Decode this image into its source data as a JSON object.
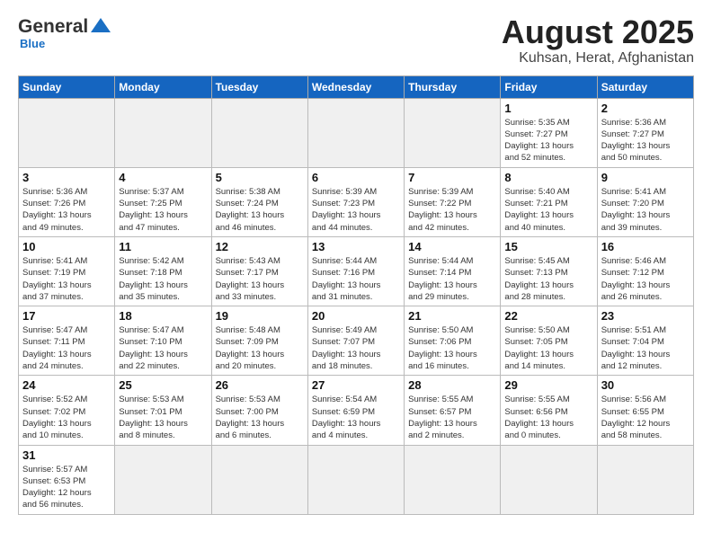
{
  "header": {
    "title": "August 2025",
    "subtitle": "Kuhsan, Herat, Afghanistan",
    "logo_general": "General",
    "logo_blue": "Blue"
  },
  "weekdays": [
    "Sunday",
    "Monday",
    "Tuesday",
    "Wednesday",
    "Thursday",
    "Friday",
    "Saturday"
  ],
  "days": [
    {
      "date": "",
      "info": ""
    },
    {
      "date": "",
      "info": ""
    },
    {
      "date": "",
      "info": ""
    },
    {
      "date": "",
      "info": ""
    },
    {
      "date": "",
      "info": ""
    },
    {
      "date": "1",
      "info": "Sunrise: 5:35 AM\nSunset: 7:27 PM\nDaylight: 13 hours\nand 52 minutes."
    },
    {
      "date": "2",
      "info": "Sunrise: 5:36 AM\nSunset: 7:27 PM\nDaylight: 13 hours\nand 50 minutes."
    },
    {
      "date": "3",
      "info": "Sunrise: 5:36 AM\nSunset: 7:26 PM\nDaylight: 13 hours\nand 49 minutes."
    },
    {
      "date": "4",
      "info": "Sunrise: 5:37 AM\nSunset: 7:25 PM\nDaylight: 13 hours\nand 47 minutes."
    },
    {
      "date": "5",
      "info": "Sunrise: 5:38 AM\nSunset: 7:24 PM\nDaylight: 13 hours\nand 46 minutes."
    },
    {
      "date": "6",
      "info": "Sunrise: 5:39 AM\nSunset: 7:23 PM\nDaylight: 13 hours\nand 44 minutes."
    },
    {
      "date": "7",
      "info": "Sunrise: 5:39 AM\nSunset: 7:22 PM\nDaylight: 13 hours\nand 42 minutes."
    },
    {
      "date": "8",
      "info": "Sunrise: 5:40 AM\nSunset: 7:21 PM\nDaylight: 13 hours\nand 40 minutes."
    },
    {
      "date": "9",
      "info": "Sunrise: 5:41 AM\nSunset: 7:20 PM\nDaylight: 13 hours\nand 39 minutes."
    },
    {
      "date": "10",
      "info": "Sunrise: 5:41 AM\nSunset: 7:19 PM\nDaylight: 13 hours\nand 37 minutes."
    },
    {
      "date": "11",
      "info": "Sunrise: 5:42 AM\nSunset: 7:18 PM\nDaylight: 13 hours\nand 35 minutes."
    },
    {
      "date": "12",
      "info": "Sunrise: 5:43 AM\nSunset: 7:17 PM\nDaylight: 13 hours\nand 33 minutes."
    },
    {
      "date": "13",
      "info": "Sunrise: 5:44 AM\nSunset: 7:16 PM\nDaylight: 13 hours\nand 31 minutes."
    },
    {
      "date": "14",
      "info": "Sunrise: 5:44 AM\nSunset: 7:14 PM\nDaylight: 13 hours\nand 29 minutes."
    },
    {
      "date": "15",
      "info": "Sunrise: 5:45 AM\nSunset: 7:13 PM\nDaylight: 13 hours\nand 28 minutes."
    },
    {
      "date": "16",
      "info": "Sunrise: 5:46 AM\nSunset: 7:12 PM\nDaylight: 13 hours\nand 26 minutes."
    },
    {
      "date": "17",
      "info": "Sunrise: 5:47 AM\nSunset: 7:11 PM\nDaylight: 13 hours\nand 24 minutes."
    },
    {
      "date": "18",
      "info": "Sunrise: 5:47 AM\nSunset: 7:10 PM\nDaylight: 13 hours\nand 22 minutes."
    },
    {
      "date": "19",
      "info": "Sunrise: 5:48 AM\nSunset: 7:09 PM\nDaylight: 13 hours\nand 20 minutes."
    },
    {
      "date": "20",
      "info": "Sunrise: 5:49 AM\nSunset: 7:07 PM\nDaylight: 13 hours\nand 18 minutes."
    },
    {
      "date": "21",
      "info": "Sunrise: 5:50 AM\nSunset: 7:06 PM\nDaylight: 13 hours\nand 16 minutes."
    },
    {
      "date": "22",
      "info": "Sunrise: 5:50 AM\nSunset: 7:05 PM\nDaylight: 13 hours\nand 14 minutes."
    },
    {
      "date": "23",
      "info": "Sunrise: 5:51 AM\nSunset: 7:04 PM\nDaylight: 13 hours\nand 12 minutes."
    },
    {
      "date": "24",
      "info": "Sunrise: 5:52 AM\nSunset: 7:02 PM\nDaylight: 13 hours\nand 10 minutes."
    },
    {
      "date": "25",
      "info": "Sunrise: 5:53 AM\nSunset: 7:01 PM\nDaylight: 13 hours\nand 8 minutes."
    },
    {
      "date": "26",
      "info": "Sunrise: 5:53 AM\nSunset: 7:00 PM\nDaylight: 13 hours\nand 6 minutes."
    },
    {
      "date": "27",
      "info": "Sunrise: 5:54 AM\nSunset: 6:59 PM\nDaylight: 13 hours\nand 4 minutes."
    },
    {
      "date": "28",
      "info": "Sunrise: 5:55 AM\nSunset: 6:57 PM\nDaylight: 13 hours\nand 2 minutes."
    },
    {
      "date": "29",
      "info": "Sunrise: 5:55 AM\nSunset: 6:56 PM\nDaylight: 13 hours\nand 0 minutes."
    },
    {
      "date": "30",
      "info": "Sunrise: 5:56 AM\nSunset: 6:55 PM\nDaylight: 12 hours\nand 58 minutes."
    },
    {
      "date": "31",
      "info": "Sunrise: 5:57 AM\nSunset: 6:53 PM\nDaylight: 12 hours\nand 56 minutes."
    }
  ]
}
